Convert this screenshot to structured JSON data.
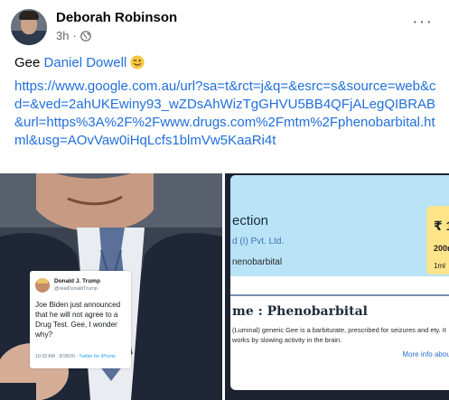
{
  "post": {
    "author": "Deborah Robinson",
    "time": "3h",
    "dot": "·",
    "more": "···",
    "text_prefix": "Gee",
    "mention": "Daniel Dowell",
    "url": "https://www.google.com.au/url?sa=t&rct=j&q=&esrc=s&source=web&cd=&ved=2ahUKEwiny93_wZDsAhWizTgGHVU5BB4QFjALegQIBRAB&url=https%3A%2F%2Fwww.drugs.com%2Fmtm%2Fphenobarbital.html&usg=AOvVaw0iHqLcfs1blmVw5KaaRi4t"
  },
  "icons": {
    "globe": "globe-icon",
    "emoji": "winking-face-icon",
    "more": "more-options-icon"
  },
  "tweet": {
    "name": "Donald J. Trump",
    "handle": "@realDonaldTrump",
    "body": "Joe Biden just announced that he will not agree to a Drug Test. Gee, I wonder why?",
    "time": "10:33 AM · 9/28/20 ·",
    "source": "Twitter for iPhone"
  },
  "webpage": {
    "title": "ection",
    "company": "d (I) Pvt. Ltd.",
    "generic": "nenobarbital",
    "price_symbol": "₹ 1",
    "dose": "200m",
    "volume": "1ml",
    "name_heading": "me : Phenobarbital",
    "description": "(Luminal) generic Gee is a barbiturate, prescribed for seizures and ety. It works by slowing activity in the brain.",
    "more_link": "More info about"
  },
  "colors": {
    "link": "#216fdb",
    "meta_gray": "#65676b",
    "web_header": "#b9e3f6",
    "price_box": "#ffe58a"
  }
}
